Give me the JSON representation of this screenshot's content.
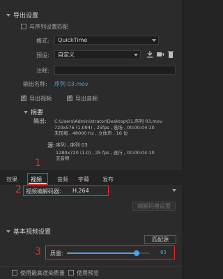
{
  "export": {
    "section_title": "导出设置",
    "match_sequence_label": "与序列设置匹配",
    "format_label": "格式:",
    "format_value": "QuickTime",
    "preset_label": "预设:",
    "preset_value": "自定义",
    "comment_label": "注释:",
    "output_name_label": "输出名称:",
    "output_name_value": "序列 03.mov",
    "export_video_label": "导出视频",
    "export_audio_label": "导出音频"
  },
  "summary": {
    "title": "摘要",
    "output_label": "输出:",
    "output_line1": "C:\\Users\\Administrator\\Desktop\\01.序列 03.mov",
    "output_line2": "720x576 (1.094) , 25fps , 低场 , 00:00:04:10",
    "output_line3": "未压缩 , 48000 Hz , 立体声 , 16 位",
    "source_label": "源:",
    "source_line1": "序列 , 序列 03",
    "source_line2": "1280x720 (1.0) , 25 fps , 逐行 , 00:00:04:10",
    "source_line3": "无音频"
  },
  "tabs": [
    "效果",
    "视频",
    "音频",
    "字幕",
    "发布"
  ],
  "video": {
    "codec_label": "视频编解码器:",
    "codec_value": "H.264",
    "codec_settings_button": "编解码器设置"
  },
  "basic_video": {
    "title": "基本视频设置",
    "match_source_button": "匹配源",
    "quality_label": "质量:",
    "quality_value": "85",
    "quality_fraction": 0.85
  },
  "footer": {
    "max_render_label": "使用最高渲染质量",
    "use_preview_label": "使用预览"
  },
  "annotations": [
    "1",
    "2",
    "3"
  ],
  "colors": {
    "accent": "#4ea3e6",
    "highlight": "#e03030"
  }
}
